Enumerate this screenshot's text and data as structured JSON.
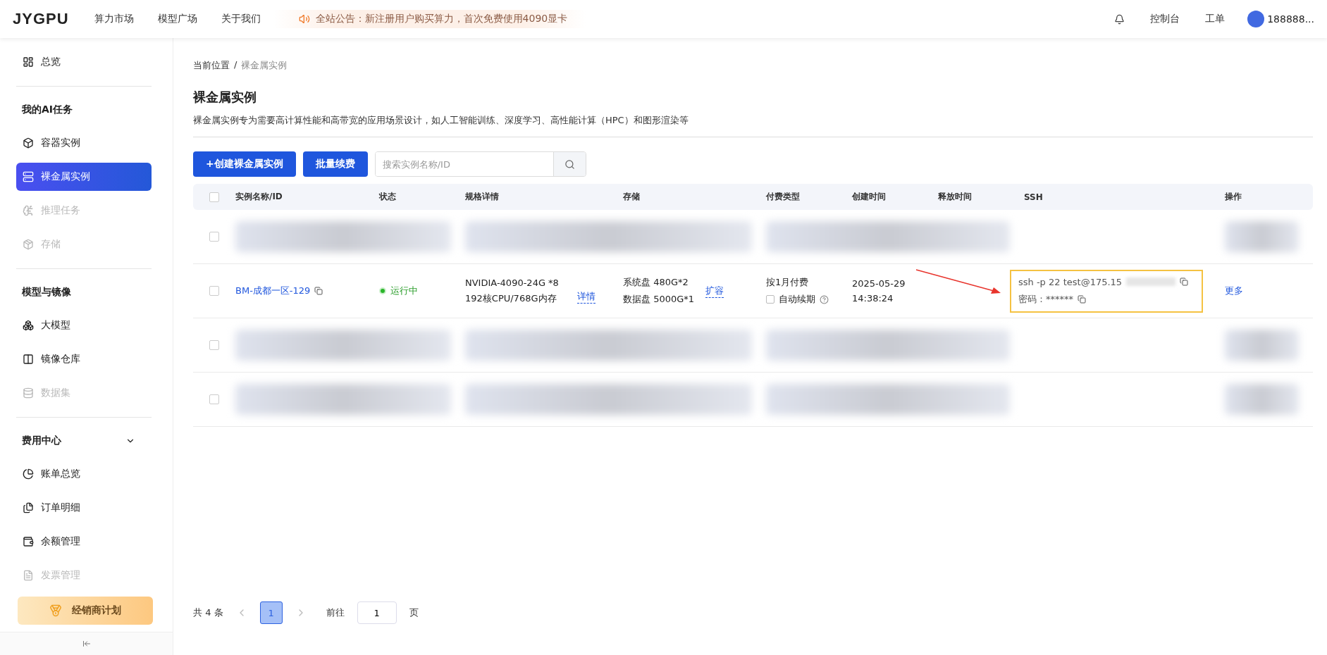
{
  "topbar": {
    "logo": "JYGPU",
    "nav": [
      "算力市场",
      "模型广场",
      "关于我们"
    ],
    "notice": "全站公告：新注册用户购买算力，首次免费使用4090显卡",
    "links": [
      "控制台",
      "工单"
    ],
    "user": "188888..."
  },
  "sidebar": {
    "sections": [
      {
        "items": [
          {
            "label": "总览",
            "selected": false,
            "disabled": false
          }
        ]
      },
      {
        "title": "我的AI任务",
        "items": [
          {
            "label": "容器实例",
            "selected": false,
            "disabled": false
          },
          {
            "label": "裸金属实例",
            "selected": true,
            "disabled": false
          },
          {
            "label": "推理任务",
            "selected": false,
            "disabled": true
          },
          {
            "label": "存储",
            "selected": false,
            "disabled": true
          }
        ]
      },
      {
        "title": "模型与镜像",
        "items": [
          {
            "label": "大模型",
            "selected": false,
            "disabled": false
          },
          {
            "label": "镜像仓库",
            "selected": false,
            "disabled": false
          },
          {
            "label": "数据集",
            "selected": false,
            "disabled": true
          }
        ]
      },
      {
        "title": "费用中心",
        "expanded": true,
        "items": [
          {
            "label": "账单总览",
            "selected": false,
            "disabled": false
          },
          {
            "label": "订单明细",
            "selected": false,
            "disabled": false
          },
          {
            "label": "余额管理",
            "selected": false,
            "disabled": false
          },
          {
            "label": "发票管理",
            "selected": false,
            "disabled": true
          }
        ]
      }
    ],
    "promo": "经销商计划"
  },
  "breadcrumb": {
    "items": [
      "当前位置",
      "裸金属实例"
    ],
    "separator": "/"
  },
  "page": {
    "title": "裸金属实例",
    "description": "裸金属实例专为需要高计算性能和高带宽的应用场景设计，如人工智能训练、深度学习、高性能计算（HPC）和图形渲染等"
  },
  "toolbar": {
    "create": "+创建裸金属实例",
    "renew": "批量续费",
    "search": {
      "placeholder": "搜索实例名称/ID"
    }
  },
  "table": {
    "header_checked": false,
    "columns": [
      "实例名称/ID",
      "状态",
      "规格详情",
      "存储",
      "付费类型",
      "创建时间",
      "释放时间",
      "SSH",
      "操作"
    ],
    "rows": [
      {
        "kind": "blurred",
        "checked": false
      },
      {
        "kind": "instance",
        "checked": false,
        "highlighted": true,
        "name": "BM-成都一区-129",
        "status": "运行中",
        "spec": [
          "NVIDIA-4090-24G *8",
          "192核CPU/768G内存"
        ],
        "spec_link": "详情",
        "storage": [
          "系统盘 480G*2",
          "数据盘 5000G*1"
        ],
        "storage_link": "扩容",
        "pay": "按1月付费",
        "auto_renew": {
          "label": "自动续期",
          "checked": false
        },
        "created": [
          "2025-05-29",
          "14:38:24"
        ],
        "ssh": "ssh -p 22 test@175.15",
        "password": "密码：******",
        "action": "更多"
      },
      {
        "kind": "blurred",
        "checked": false
      },
      {
        "kind": "blurred",
        "checked": false
      }
    ]
  },
  "pagination": {
    "total": "共 4 条",
    "pages": [
      {
        "label": "1",
        "selected": true
      }
    ],
    "goto": "前往",
    "goto_value": "1",
    "page_unit": "页"
  }
}
